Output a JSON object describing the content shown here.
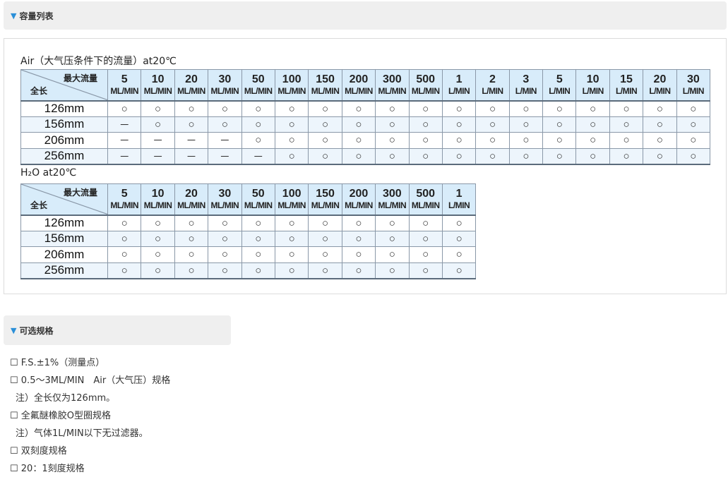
{
  "sections": {
    "capacity": {
      "marker": "▼",
      "title": "容量列表"
    },
    "options": {
      "marker": "▼",
      "title": "可选规格"
    }
  },
  "air_table": {
    "title": "Air（大气压条件下的流量）at20℃",
    "corner_top": "最大流量",
    "corner_bottom": "全长",
    "columns": [
      {
        "value": "5",
        "unit": "ML/MIN"
      },
      {
        "value": "10",
        "unit": "ML/MIN"
      },
      {
        "value": "20",
        "unit": "ML/MIN"
      },
      {
        "value": "30",
        "unit": "ML/MIN"
      },
      {
        "value": "50",
        "unit": "ML/MIN"
      },
      {
        "value": "100",
        "unit": "ML/MIN"
      },
      {
        "value": "150",
        "unit": "ML/MIN"
      },
      {
        "value": "200",
        "unit": "ML/MIN"
      },
      {
        "value": "300",
        "unit": "ML/MIN"
      },
      {
        "value": "500",
        "unit": "ML/MIN"
      },
      {
        "value": "1",
        "unit": "L/MIN"
      },
      {
        "value": "2",
        "unit": "L/MIN"
      },
      {
        "value": "3",
        "unit": "L/MIN"
      },
      {
        "value": "5",
        "unit": "L/MIN"
      },
      {
        "value": "10",
        "unit": "L/MIN"
      },
      {
        "value": "15",
        "unit": "L/MIN"
      },
      {
        "value": "20",
        "unit": "L/MIN"
      },
      {
        "value": "30",
        "unit": "L/MIN"
      }
    ],
    "rows": [
      {
        "length": "126mm",
        "cells": [
          "○",
          "○",
          "○",
          "○",
          "○",
          "○",
          "○",
          "○",
          "○",
          "○",
          "○",
          "○",
          "○",
          "○",
          "○",
          "○",
          "○",
          "○"
        ]
      },
      {
        "length": "156mm",
        "cells": [
          "－",
          "○",
          "○",
          "○",
          "○",
          "○",
          "○",
          "○",
          "○",
          "○",
          "○",
          "○",
          "○",
          "○",
          "○",
          "○",
          "○",
          "○"
        ]
      },
      {
        "length": "206mm",
        "cells": [
          "－",
          "－",
          "－",
          "－",
          "○",
          "○",
          "○",
          "○",
          "○",
          "○",
          "○",
          "○",
          "○",
          "○",
          "○",
          "○",
          "○",
          "○"
        ]
      },
      {
        "length": "256mm",
        "cells": [
          "－",
          "－",
          "－",
          "－",
          "－",
          "○",
          "○",
          "○",
          "○",
          "○",
          "○",
          "○",
          "○",
          "○",
          "○",
          "○",
          "○",
          "○"
        ]
      }
    ]
  },
  "h2o_table": {
    "title": "H₂O at20℃",
    "corner_top": "最大流量",
    "corner_bottom": "全长",
    "columns": [
      {
        "value": "5",
        "unit": "ML/MIN"
      },
      {
        "value": "10",
        "unit": "ML/MIN"
      },
      {
        "value": "20",
        "unit": "ML/MIN"
      },
      {
        "value": "30",
        "unit": "ML/MIN"
      },
      {
        "value": "50",
        "unit": "ML/MIN"
      },
      {
        "value": "100",
        "unit": "ML/MIN"
      },
      {
        "value": "150",
        "unit": "ML/MIN"
      },
      {
        "value": "200",
        "unit": "ML/MIN"
      },
      {
        "value": "300",
        "unit": "ML/MIN"
      },
      {
        "value": "500",
        "unit": "ML/MIN"
      },
      {
        "value": "1",
        "unit": "L/MIN"
      }
    ],
    "rows": [
      {
        "length": "126mm",
        "cells": [
          "○",
          "○",
          "○",
          "○",
          "○",
          "○",
          "○",
          "○",
          "○",
          "○",
          "○"
        ]
      },
      {
        "length": "156mm",
        "cells": [
          "○",
          "○",
          "○",
          "○",
          "○",
          "○",
          "○",
          "○",
          "○",
          "○",
          "○"
        ]
      },
      {
        "length": "206mm",
        "cells": [
          "○",
          "○",
          "○",
          "○",
          "○",
          "○",
          "○",
          "○",
          "○",
          "○",
          "○"
        ]
      },
      {
        "length": "256mm",
        "cells": [
          "○",
          "○",
          "○",
          "○",
          "○",
          "○",
          "○",
          "○",
          "○",
          "○",
          "○"
        ]
      }
    ]
  },
  "options_list": [
    {
      "kind": "item",
      "text": "☐ F.S.±1%（测量点）"
    },
    {
      "kind": "item",
      "text": "☐ 0.5～3ML/MIN　Air（大气压）规格"
    },
    {
      "kind": "note",
      "text": "注）全长仅为126mm。"
    },
    {
      "kind": "item",
      "text": "☐ 全氟醚橡胶O型圈规格"
    },
    {
      "kind": "note",
      "text": "注）气体1L/MIN以下无过滤器。"
    },
    {
      "kind": "item",
      "text": "☐ 双刻度规格"
    },
    {
      "kind": "item",
      "text": "☐ 20：1刻度规格"
    }
  ]
}
